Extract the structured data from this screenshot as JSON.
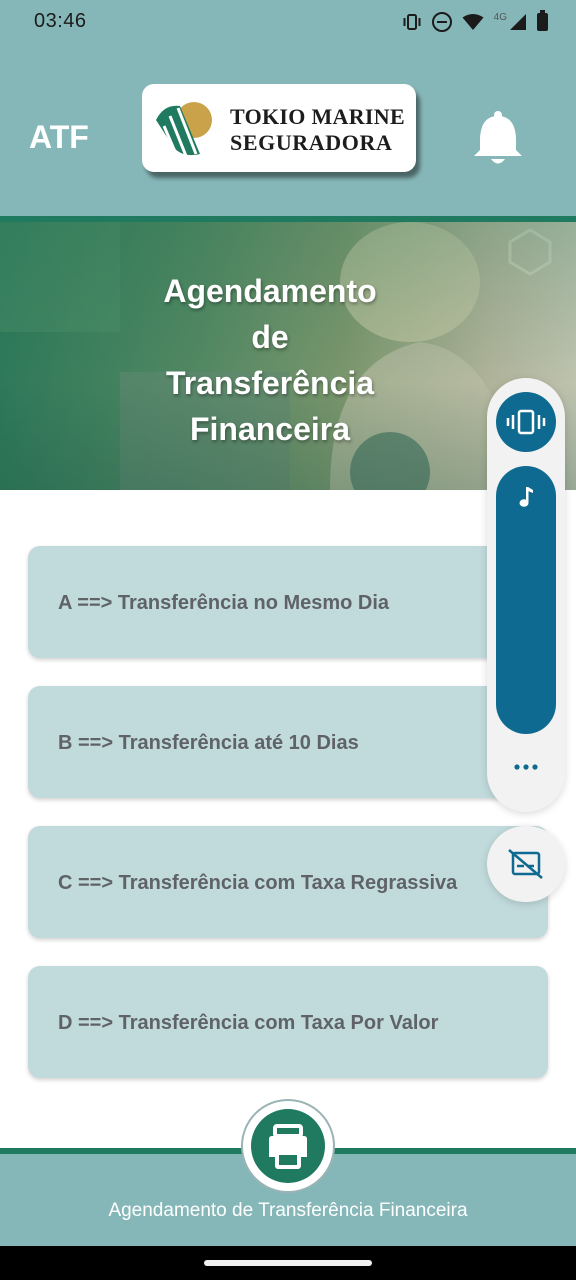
{
  "status_bar": {
    "time": "03:46",
    "network_label": "4G",
    "icons": [
      "vibrate-icon",
      "do-not-disturb-icon",
      "wifi-icon",
      "signal-icon",
      "battery-icon"
    ]
  },
  "header": {
    "app_abbrev": "ATF",
    "logo": {
      "line1": "TOKIO MARINE",
      "line2": "SEGURADORA"
    },
    "notification_icon": "bell-icon"
  },
  "banner": {
    "title_lines": [
      "Agendamento",
      "de",
      "Transferência",
      "Financeira"
    ]
  },
  "options": [
    {
      "label": "A ==> Transferência no Mesmo Dia"
    },
    {
      "label": "B ==> Transferência até 10 Dias"
    },
    {
      "label": "C ==> Transferência com Taxa Regrassiva"
    },
    {
      "label": "D ==> Transferência com Taxa Por Valor"
    }
  ],
  "volume_panel": {
    "mode_icon": "vibrate-icon",
    "stream_icon": "music-note-icon",
    "level": 1.0,
    "more_icon": "more-dots-icon",
    "caption_icon": "captions-off-icon"
  },
  "footer": {
    "title": "Agendamento de Transferência Financeira",
    "action_icon": "printer-icon"
  },
  "colors": {
    "header_bg": "#86b7b8",
    "accent_green": "#1f7a5f",
    "card_bg": "#c1dadc",
    "card_text": "#5f6368",
    "volume_blue": "#0e6a90"
  }
}
